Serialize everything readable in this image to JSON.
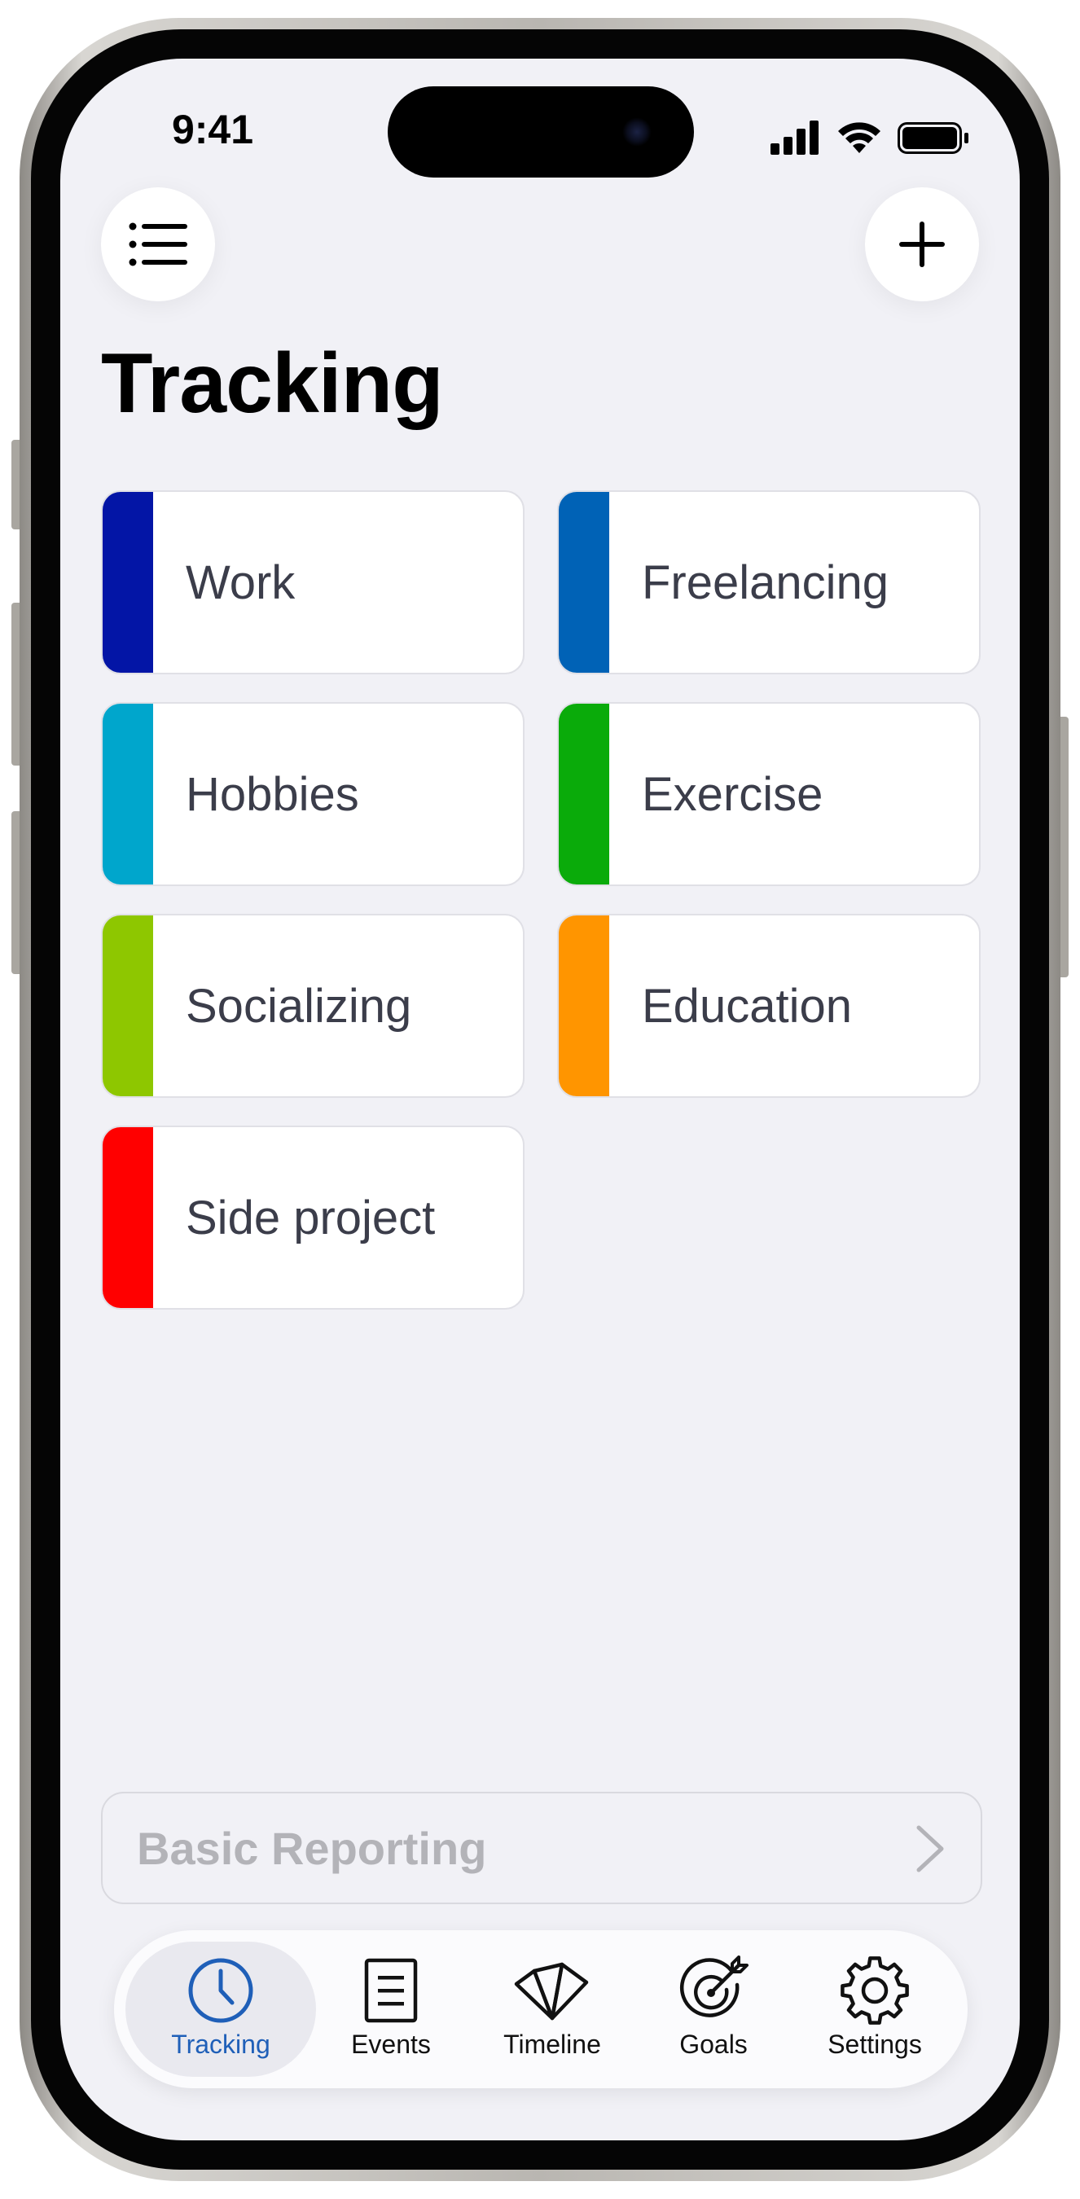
{
  "status_bar": {
    "time": "9:41"
  },
  "header": {
    "title": "Tracking"
  },
  "categories": [
    {
      "label": "Work",
      "color": "#0315a6"
    },
    {
      "label": "Freelancing",
      "color": "#0062b6"
    },
    {
      "label": "Hobbies",
      "color": "#00a6cc"
    },
    {
      "label": "Exercise",
      "color": "#0aab0a"
    },
    {
      "label": "Socializing",
      "color": "#8ec700"
    },
    {
      "label": "Education",
      "color": "#ff9500"
    },
    {
      "label": "Side project",
      "color": "#ff0000"
    }
  ],
  "reporting": {
    "label": "Basic Reporting"
  },
  "tabs": [
    {
      "label": "Tracking",
      "icon": "clock-icon",
      "active": true
    },
    {
      "label": "Events",
      "icon": "document-icon"
    },
    {
      "label": "Timeline",
      "icon": "fan-icon"
    },
    {
      "label": "Goals",
      "icon": "target-icon"
    },
    {
      "label": "Settings",
      "icon": "gear-icon"
    }
  ],
  "colors": {
    "accent": "#1f5fb8",
    "background": "#f1f1f6"
  }
}
